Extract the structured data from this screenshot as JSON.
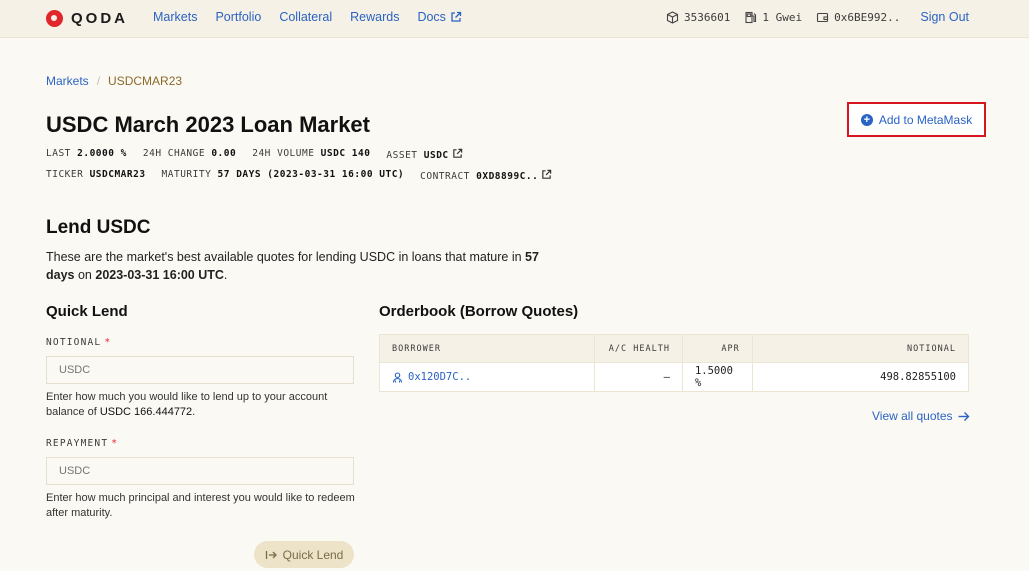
{
  "header": {
    "logo_text": "QODA",
    "nav": [
      "Markets",
      "Portfolio",
      "Collateral",
      "Rewards",
      "Docs"
    ],
    "block_number": "3536601",
    "gas": "1 Gwei",
    "wallet": "0x6BE992..",
    "sign_out": "Sign Out"
  },
  "breadcrumb": {
    "parent": "Markets",
    "current": "USDCMAR23"
  },
  "market": {
    "title": "USDC March 2023 Loan Market",
    "last_label": "LAST",
    "last_value": "2.0000 %",
    "change_label": "24H CHANGE",
    "change_value": "0.00",
    "volume_label": "24H VOLUME",
    "volume_value": "USDC 140",
    "asset_label": "ASSET",
    "asset_value": "USDC",
    "ticker_label": "TICKER",
    "ticker_value": "USDCMAR23",
    "maturity_label": "MATURITY",
    "maturity_value": "57 DAYS (2023-03-31 16:00 UTC)",
    "contract_label": "CONTRACT",
    "contract_value": "0XD8899C.."
  },
  "metamask_button": "Add to MetaMask",
  "lend": {
    "title": "Lend USDC",
    "desc_part1": "These are the market's best available quotes for lending USDC in loans that mature in",
    "desc_days": "57 days",
    "desc_on": "on",
    "desc_date": "2023-03-31 16:00 UTC",
    "desc_end": "."
  },
  "quick_lend": {
    "title": "Quick Lend",
    "notional_label": "NOTIONAL",
    "notional_placeholder": "USDC",
    "notional_help_1": "Enter how much you would like to lend up to your account balance of",
    "notional_help_balance": "USDC 166.444772",
    "notional_help_end": ".",
    "repayment_label": "REPAYMENT",
    "repayment_placeholder": "USDC",
    "repayment_help": "Enter how much principal and interest you would like to redeem after maturity.",
    "button": "Quick Lend",
    "required_mark": "*"
  },
  "orderbook": {
    "title": "Orderbook (Borrow Quotes)",
    "columns": [
      "BORROWER",
      "A/C HEALTH",
      "APR",
      "NOTIONAL"
    ],
    "rows": [
      {
        "borrower": "0x120D7C..",
        "health": "—",
        "apr": "1.5000 %",
        "notional": "498.82855100"
      }
    ],
    "view_all": "View all quotes"
  },
  "colors": {
    "accent": "#2a63c4",
    "brand_red": "#e1262c",
    "highlight_border": "#d8161f"
  }
}
